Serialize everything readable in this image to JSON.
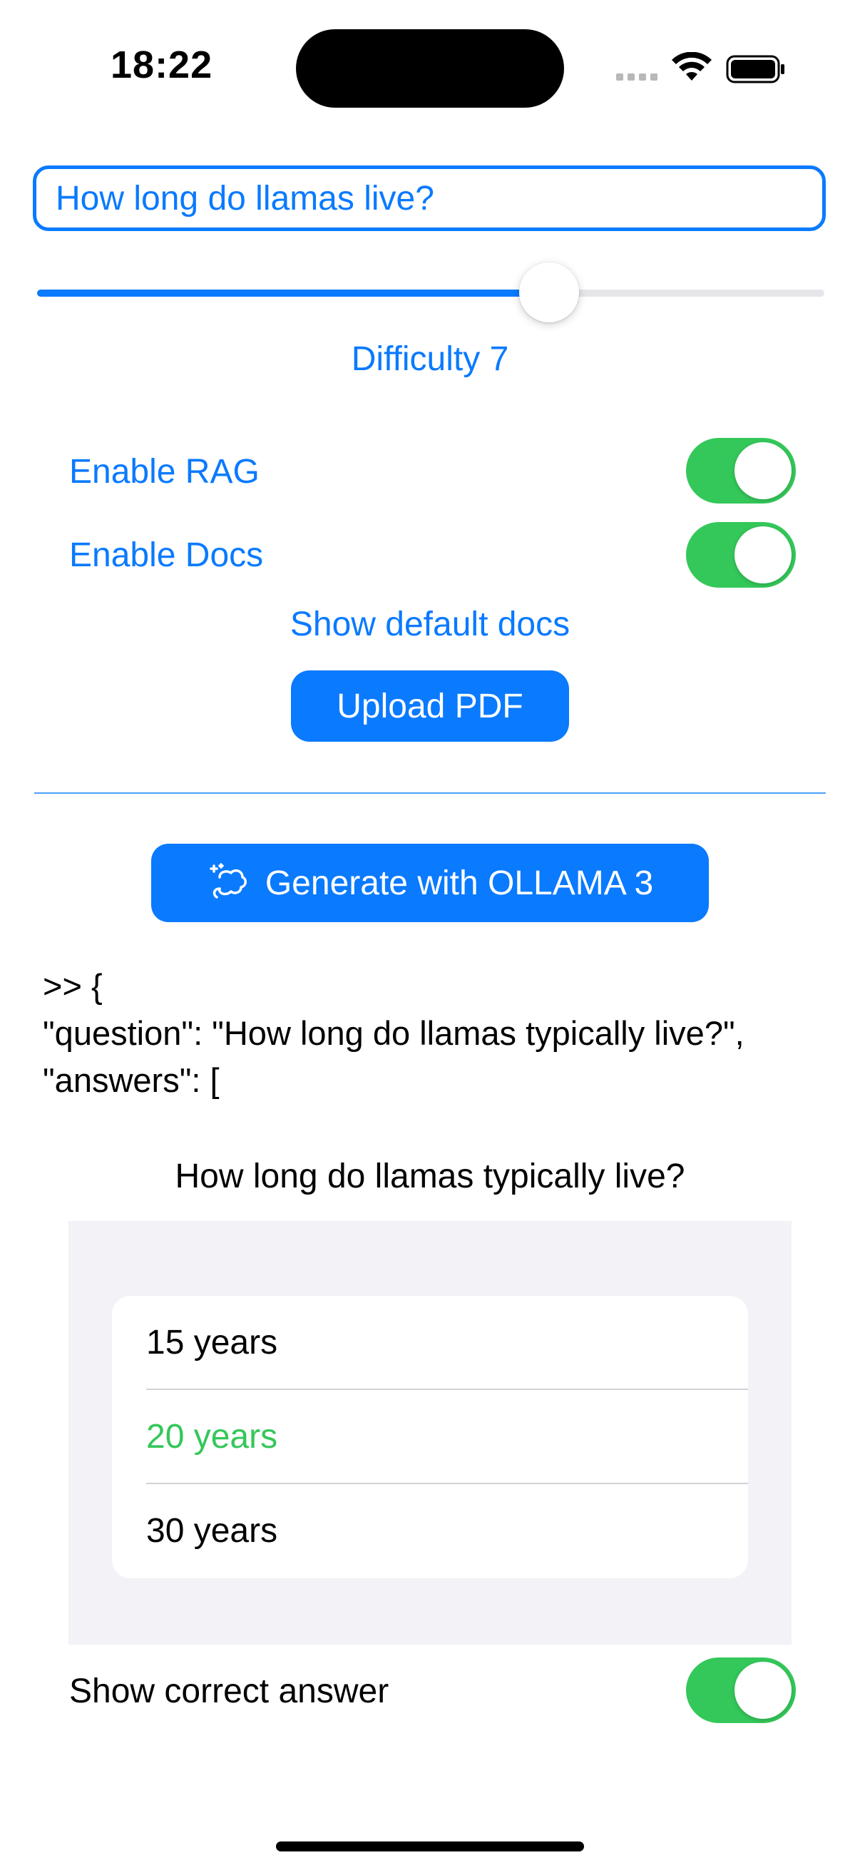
{
  "status_bar": {
    "time": "18:22"
  },
  "query": {
    "value": "How long do llamas live?"
  },
  "difficulty": {
    "label": "Difficulty 7",
    "slider_fraction": 0.65
  },
  "toggles": {
    "rag_label": "Enable RAG",
    "rag_on": true,
    "docs_label": "Enable Docs",
    "docs_on": true
  },
  "show_docs_label": "Show default docs",
  "upload_label": "Upload PDF",
  "generate_label": "Generate with OLLAMA 3",
  "raw_output": {
    "line1": ">> {",
    "line2": "\"question\": \"How long do llamas typically live?\",",
    "line3": "\"answers\": ["
  },
  "quiz": {
    "question": "How long do llamas typically live?",
    "answers": [
      {
        "text": "15 years",
        "correct": false
      },
      {
        "text": "20 years",
        "correct": true
      },
      {
        "text": "30 years",
        "correct": false
      }
    ],
    "show_correct_label": "Show correct answer",
    "show_correct_on": true
  },
  "colors": {
    "accent": "#0a7aff",
    "toggle_on": "#34c759",
    "correct": "#34c759",
    "panel_bg": "#f2f2f7"
  },
  "icons": {
    "generate_icon": "sparkles-loop-icon",
    "wifi": "wifi-icon",
    "battery": "battery-icon"
  }
}
